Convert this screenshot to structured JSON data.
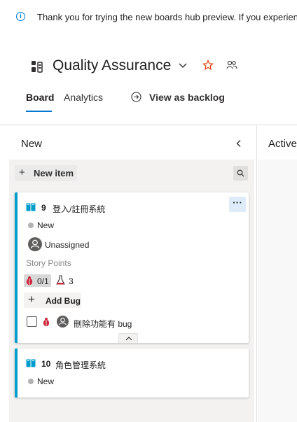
{
  "banner": {
    "message": "Thank you for trying the new boards hub preview. If you experien"
  },
  "header": {
    "title": "Quality Assurance"
  },
  "tabs": {
    "board": "Board",
    "analytics": "Analytics",
    "backlog": "View as backlog"
  },
  "columns": [
    {
      "name": "New"
    },
    {
      "name": "Active"
    }
  ],
  "toolbar": {
    "new_item_label": "New item"
  },
  "cards": [
    {
      "id": "9",
      "title": "登入/註冊系統",
      "state": "New",
      "assigned": "Unassigned",
      "field_label": "Story Points",
      "bug_progress": "0/1",
      "test_count": "3",
      "add_bug_label": "Add Bug",
      "child_title": "刪除功能有 bug"
    },
    {
      "id": "10",
      "title": "角色管理系統",
      "state": "New"
    }
  ],
  "colors": {
    "accent": "#0078d4",
    "card_border": "#009ccc",
    "bug_red": "#cc293d"
  },
  "icons": [
    "info-icon",
    "team-icon",
    "chevron-down-icon",
    "star-icon",
    "people-icon",
    "backlog-icon",
    "collapse-icon",
    "plus-icon",
    "search-icon",
    "book-icon",
    "more-icon",
    "bug-icon",
    "flask-icon",
    "avatar-icon",
    "chevron-up-icon"
  ]
}
